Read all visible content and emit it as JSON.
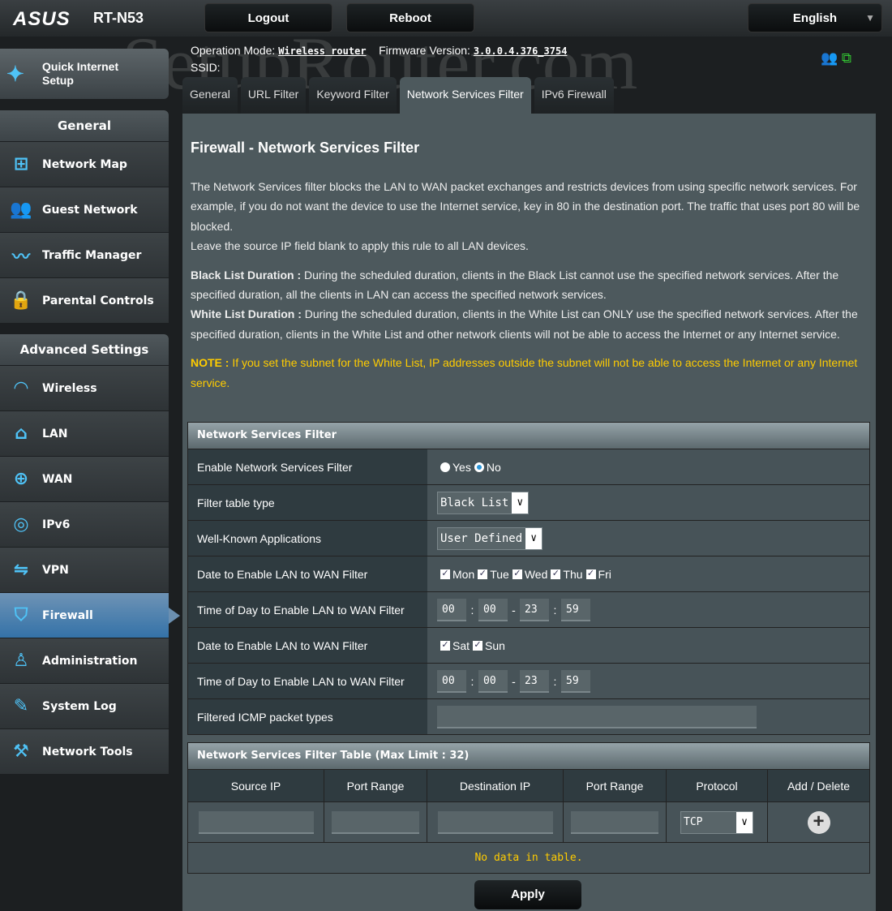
{
  "header": {
    "brand": "ASUS",
    "model": "RT-N53",
    "logout": "Logout",
    "reboot": "Reboot",
    "language": "English",
    "op_mode_label": "Operation Mode:",
    "op_mode": "Wireless router",
    "fw_label": "Firmware Version:",
    "fw": "3.0.0.4.376_3754",
    "ssid_label": "SSID:",
    "watermark": "SetupRouter.com"
  },
  "tabs": [
    "General",
    "URL Filter",
    "Keyword Filter",
    "Network Services Filter",
    "IPv6 Firewall"
  ],
  "sidebar": {
    "qis": "Quick Internet Setup",
    "general": "General",
    "general_items": [
      {
        "label": "Network Map",
        "icon": "network-map-icon"
      },
      {
        "label": "Guest Network",
        "icon": "guest-network-icon"
      },
      {
        "label": "Traffic Manager",
        "icon": "traffic-manager-icon"
      },
      {
        "label": "Parental Controls",
        "icon": "lock-icon"
      }
    ],
    "advanced": "Advanced Settings",
    "advanced_items": [
      {
        "label": "Wireless"
      },
      {
        "label": "LAN"
      },
      {
        "label": "WAN"
      },
      {
        "label": "IPv6"
      },
      {
        "label": "VPN"
      },
      {
        "label": "Firewall"
      },
      {
        "label": "Administration"
      },
      {
        "label": "System Log"
      },
      {
        "label": "Network Tools"
      }
    ],
    "active": "Firewall"
  },
  "main": {
    "title": "Firewall - Network Services Filter",
    "p1": "The Network Services filter blocks the LAN to WAN packet exchanges and restricts devices from using specific network services. For example, if you do not want the device to use the Internet service, key in 80 in the destination port. The traffic that uses port 80 will be blocked.",
    "p1b": "Leave the source IP field blank to apply this rule to all LAN devices.",
    "bl_label": "Black List Duration :",
    "bl_text": " During the scheduled duration, clients in the Black List cannot use the specified network services. After the specified duration, all the clients in LAN can access the specified network services.",
    "wl_label": "White List Duration :",
    "wl_text": " During the scheduled duration, clients in the White List can ONLY use the specified network services. After the specified duration, clients in the White List and other network clients will not be able to access the Internet or any Internet service.",
    "note_label": "NOTE :",
    "note_text": " If you set the subnet for the White List, IP addresses outside the subnet will not be able to access the Internet or any Internet service.",
    "filter": {
      "heading": "Network Services Filter",
      "enable_label": "Enable Network Services Filter",
      "yes": "Yes",
      "no": "No",
      "enabled": false,
      "type_label": "Filter table type",
      "type_value": "Black List",
      "apps_label": "Well-Known Applications",
      "apps_value": "User Defined",
      "date1_label": "Date to Enable LAN to WAN Filter",
      "weekdays": [
        "Mon",
        "Tue",
        "Wed",
        "Thu",
        "Fri"
      ],
      "time1_label": "Time of Day to Enable LAN to WAN Filter",
      "time1": [
        "00",
        "00",
        "23",
        "59"
      ],
      "date2_label": "Date to Enable LAN to WAN Filter",
      "weekend": [
        "Sat",
        "Sun"
      ],
      "time2_label": "Time of Day to Enable LAN to WAN Filter",
      "time2": [
        "00",
        "00",
        "23",
        "59"
      ],
      "icmp_label": "Filtered ICMP packet types",
      "icmp_value": ""
    },
    "table": {
      "heading": "Network Services Filter Table (Max Limit : 32)",
      "columns": [
        "Source IP",
        "Port Range",
        "Destination IP",
        "Port Range",
        "Protocol",
        "Add / Delete"
      ],
      "protocol": "TCP",
      "empty": "No data in table."
    },
    "apply": "Apply"
  }
}
